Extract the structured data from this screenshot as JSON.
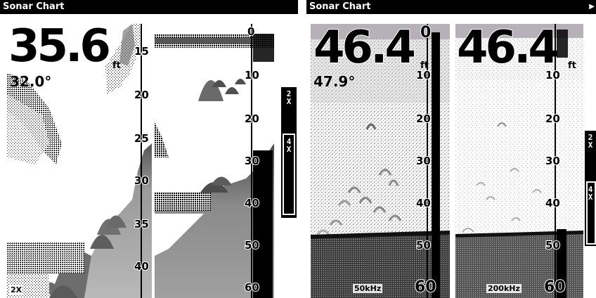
{
  "left": {
    "title": "Sonar Chart",
    "depth": "35.6",
    "depth_unit": "ft",
    "temperature": "32.0°",
    "zoom_label": "2X",
    "left_scale": [
      "15",
      "20",
      "25",
      "30",
      "35",
      "40"
    ],
    "right_scale": [
      "0",
      "10",
      "20",
      "30",
      "40",
      "50",
      "60"
    ],
    "zoom_bar": {
      "top": "2\nX",
      "bottom": "4\nX"
    }
  },
  "right": {
    "title": "Sonar Chart",
    "left_pane": {
      "depth": "46.4",
      "depth_unit": "ft",
      "temperature": "47.9°",
      "frequency": "50kHz",
      "scale": [
        "0",
        "10",
        "20",
        "30",
        "40",
        "50"
      ],
      "bottom_depth": "60"
    },
    "right_pane": {
      "depth": "46.4",
      "depth_unit": "ft",
      "frequency": "200kHz",
      "scale": [
        "10",
        "20",
        "30",
        "40",
        "50"
      ],
      "bottom_depth": "60"
    },
    "zoom_bar": {
      "top": "2\nX",
      "bottom": "4\nX"
    }
  },
  "colors": {
    "title_bg": "#000000",
    "title_fg": "#ffffff",
    "surface_band": "#b6b0b8",
    "bottom_gray": "#8a8a8a",
    "water": "#ffffff"
  }
}
